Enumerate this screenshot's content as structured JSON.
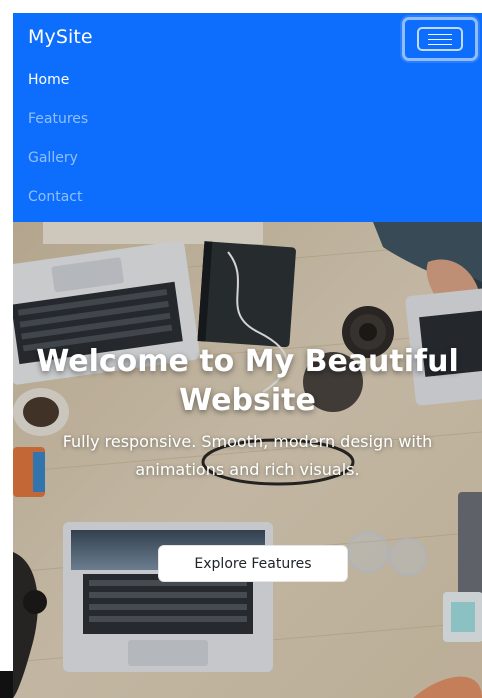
{
  "navbar": {
    "brand": "MySite",
    "toggler_icon": "hamburger-menu-icon",
    "background_color": "#0d6efd",
    "items": [
      {
        "label": "Home",
        "active": true
      },
      {
        "label": "Features",
        "active": false
      },
      {
        "label": "Gallery",
        "active": false
      },
      {
        "label": "Contact",
        "active": false
      }
    ]
  },
  "hero": {
    "title": "Welcome to My Beautiful Website",
    "subtitle": "Fully responsive. Smooth, modern design with animations and rich visuals.",
    "button_label": "Explore Features"
  }
}
